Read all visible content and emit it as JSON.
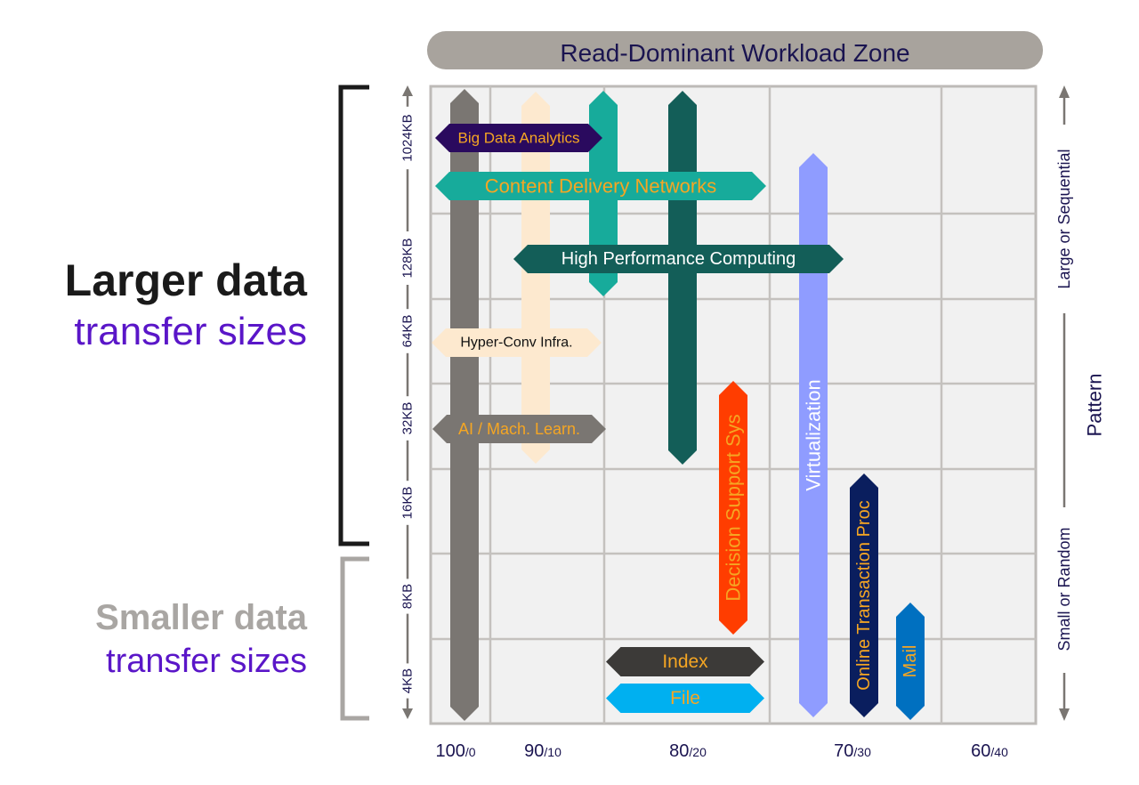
{
  "header": {
    "title": "Read-Dominant Workload Zone",
    "color": "#a8a39d",
    "text_color": "#1a1450"
  },
  "left_labels": {
    "larger_line1": "Larger data",
    "larger_line2": "transfer sizes",
    "smaller_line1": "Smaller data",
    "smaller_line2": "transfer sizes",
    "accent_color": "#5a16c8"
  },
  "y_axis": {
    "ticks": [
      "1024KB",
      "128KB",
      "64KB",
      "32KB",
      "16KB",
      "8KB",
      "4KB"
    ]
  },
  "x_axis": {
    "ticks": [
      {
        "main": "100",
        "sub": "/0"
      },
      {
        "main": "90",
        "sub": "/10"
      },
      {
        "main": "80",
        "sub": "/20"
      },
      {
        "main": "70",
        "sub": "/30"
      },
      {
        "main": "60",
        "sub": "/40"
      }
    ]
  },
  "right_axis": {
    "top": "Large or Sequential",
    "middle": "Pattern",
    "bottom": "Small or Random"
  },
  "workloads": [
    {
      "id": "gray-vertical",
      "label": "",
      "color": "#7a7672"
    },
    {
      "id": "cream-vertical",
      "label": "",
      "color": "#fde9cf"
    },
    {
      "id": "teal-vertical",
      "label": "",
      "color": "#17ab9b"
    },
    {
      "id": "darkteal-vertical",
      "label": "",
      "color": "#135e58"
    },
    {
      "id": "decision-support",
      "label": "Decision Support Sys",
      "color": "#ff3d00",
      "text_color": "#f5a623"
    },
    {
      "id": "virtualization",
      "label": "Virtualization",
      "color": "#8f9cff",
      "text_color": "#ffffff"
    },
    {
      "id": "oltp",
      "label": "Online Transaction Proc",
      "color": "#0a1e5e",
      "text_color": "#f5a623"
    },
    {
      "id": "mail",
      "label": "Mail",
      "color": "#0070c0",
      "text_color": "#f5a623"
    },
    {
      "id": "big-data",
      "label": "Big Data Analytics",
      "color": "#2a0a5e",
      "text_color": "#f5a623"
    },
    {
      "id": "cdn",
      "label": "Content Delivery Networks",
      "color": "#17ab9b",
      "text_color": "#f5a623"
    },
    {
      "id": "hpc",
      "label": "High Performance Computing",
      "color": "#135e58",
      "text_color": "#ffffff"
    },
    {
      "id": "hci",
      "label": "Hyper-Conv Infra.",
      "color": "#fde9cf",
      "text_color": "#111111"
    },
    {
      "id": "ai-ml",
      "label": "AI / Mach. Learn.",
      "color": "#7a7672",
      "text_color": "#f5a623"
    },
    {
      "id": "index",
      "label": "Index",
      "color": "#3c3a38",
      "text_color": "#f5a623"
    },
    {
      "id": "file",
      "label": "File",
      "color": "#00b0f0",
      "text_color": "#f5a623"
    }
  ]
}
